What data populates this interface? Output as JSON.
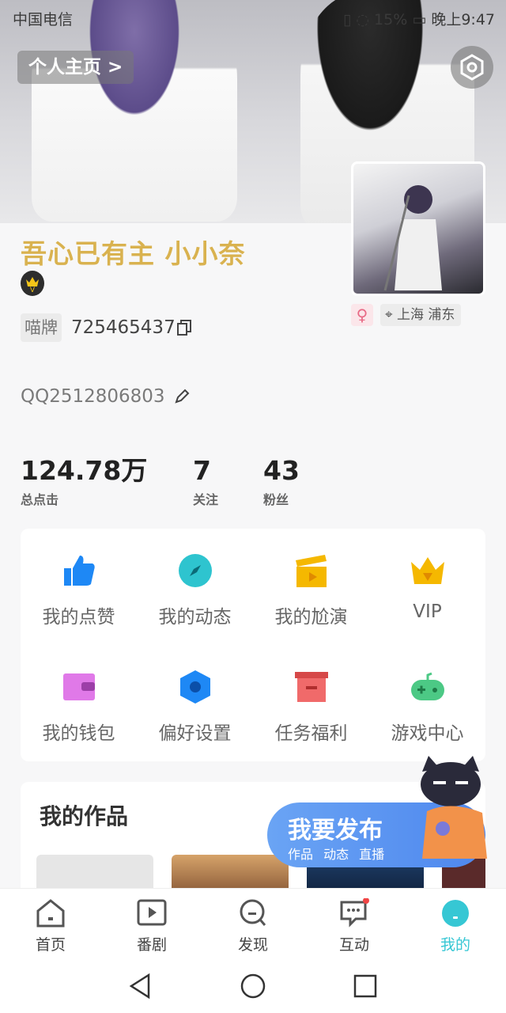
{
  "status_bar": {
    "carrier": "中国电信",
    "battery": "15%",
    "time": "晚上9:47"
  },
  "header": {
    "homepage_label": "个人主页 >"
  },
  "profile": {
    "nickname": "吾心已有主 小小奈",
    "gender_symbol": "♀",
    "location": "上海 浦东",
    "tag_label": "喵牌",
    "uid": "725465437",
    "signature": "QQ2512806803"
  },
  "stats": [
    {
      "value": "124.78万",
      "label": "总点击"
    },
    {
      "value": "7",
      "label": "关注"
    },
    {
      "value": "43",
      "label": "粉丝"
    }
  ],
  "menu": [
    {
      "label": "我的点赞",
      "icon": "thumbs-up-icon",
      "color": "#1e88f5"
    },
    {
      "label": "我的动态",
      "icon": "compass-icon",
      "color": "#2ec4cf"
    },
    {
      "label": "我的尬演",
      "icon": "clapperboard-icon",
      "color": "#f5b800"
    },
    {
      "label": "VIP",
      "icon": "crown-icon",
      "color": "#f5b800"
    },
    {
      "label": "我的钱包",
      "icon": "wallet-icon",
      "color": "#e079e8"
    },
    {
      "label": "偏好设置",
      "icon": "hexagon-gear-icon",
      "color": "#1e88f5"
    },
    {
      "label": "任务福利",
      "icon": "box-icon",
      "color": "#f06a6a"
    },
    {
      "label": "游戏中心",
      "icon": "gamepad-icon",
      "color": "#4cc985"
    }
  ],
  "works": {
    "title": "我的作品"
  },
  "publish": {
    "title": "我要发布",
    "subs": "作品 动态 直播"
  },
  "tabs": [
    {
      "label": "首页",
      "icon": "home-icon"
    },
    {
      "label": "番剧",
      "icon": "play-icon"
    },
    {
      "label": "发现",
      "icon": "discover-icon"
    },
    {
      "label": "互动",
      "icon": "chat-icon"
    },
    {
      "label": "我的",
      "icon": "me-icon",
      "active": true
    }
  ],
  "colors": {
    "accent": "#36c7d4",
    "nickname": "#d9b24f",
    "publish": "#5a93f0"
  }
}
